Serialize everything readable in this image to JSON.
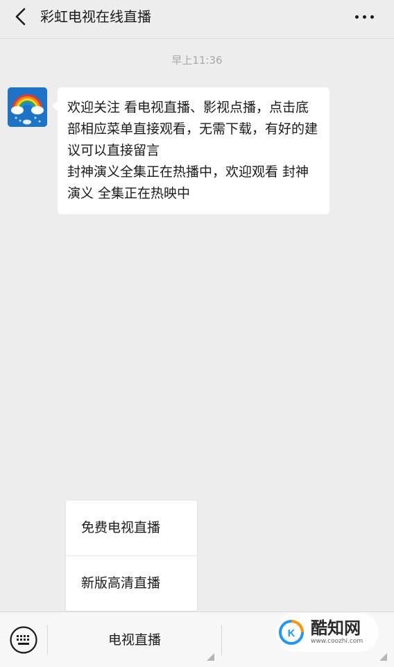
{
  "header": {
    "title": "彩虹电视在线直播",
    "back_icon": "chevron-left-icon",
    "more_icon": "more-dots-icon"
  },
  "chat": {
    "timestamp": "早上11:36",
    "avatar_icon": "rainbow-cloud-avatar",
    "message_lines": [
      "欢迎关注 看电视直播、影视点播，点击底部相应菜单直接观看，无需下载，有好的建议可以直接留言",
      "封神演义全集正在热播中，欢迎观看 封神演义 全集正在热映中"
    ]
  },
  "popup": {
    "items": [
      {
        "label": "免费电视直播"
      },
      {
        "label": "新版高清直播"
      }
    ]
  },
  "bottom_bar": {
    "keyboard_icon": "keyboard-icon",
    "menus": [
      {
        "label": "电视直播"
      },
      {
        "label": ""
      }
    ]
  },
  "watermark": {
    "name": "酷知网",
    "url": "www.coozhi.com"
  },
  "colors": {
    "background": "#ededed",
    "bubble": "#ffffff",
    "avatar_bg": "#1f73c6"
  }
}
